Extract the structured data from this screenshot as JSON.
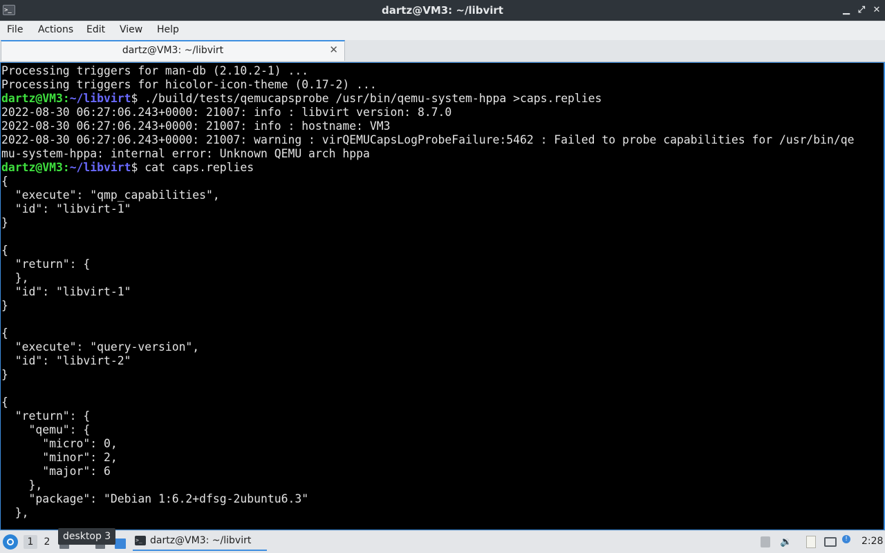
{
  "window": {
    "title": "dartz@VM3: ~/libvirt",
    "app_icon_glyph": ">_",
    "controls": {
      "minimize": "▁",
      "restore": "⤢",
      "close": "✕"
    }
  },
  "menu": {
    "items": [
      {
        "label": "File"
      },
      {
        "label": "Actions"
      },
      {
        "label": "Edit"
      },
      {
        "label": "View"
      },
      {
        "label": "Help"
      }
    ]
  },
  "tab": {
    "label": "dartz@VM3: ~/libvirt",
    "close_glyph": "✕"
  },
  "terminal": {
    "lines": [
      {
        "text": "Processing triggers for man-db (2.10.2-1) ..."
      },
      {
        "text": "Processing triggers for hicolor-icon-theme (0.17-2) ..."
      },
      {
        "prompt_user": "dartz@VM3",
        "prompt_sep": ":",
        "prompt_path": "~/libvirt",
        "prompt_sym": "$",
        "text": " ./build/tests/qemucapsprobe /usr/bin/qemu-system-hppa >caps.replies"
      },
      {
        "text": "2022-08-30 06:27:06.243+0000: 21007: info : libvirt version: 8.7.0"
      },
      {
        "text": "2022-08-30 06:27:06.243+0000: 21007: info : hostname: VM3"
      },
      {
        "text": "2022-08-30 06:27:06.243+0000: 21007: warning : virQEMUCapsLogProbeFailure:5462 : Failed to probe capabilities for /usr/bin/qe"
      },
      {
        "text": "mu-system-hppa: internal error: Unknown QEMU arch hppa"
      },
      {
        "prompt_user": "dartz@VM3",
        "prompt_sep": ":",
        "prompt_path": "~/libvirt",
        "prompt_sym": "$",
        "text": " cat caps.replies"
      },
      {
        "text": "{"
      },
      {
        "text": "  \"execute\": \"qmp_capabilities\","
      },
      {
        "text": "  \"id\": \"libvirt-1\""
      },
      {
        "text": "}"
      },
      {
        "text": ""
      },
      {
        "text": "{"
      },
      {
        "text": "  \"return\": {"
      },
      {
        "text": "  },"
      },
      {
        "text": "  \"id\": \"libvirt-1\""
      },
      {
        "text": "}"
      },
      {
        "text": ""
      },
      {
        "text": "{"
      },
      {
        "text": "  \"execute\": \"query-version\","
      },
      {
        "text": "  \"id\": \"libvirt-2\""
      },
      {
        "text": "}"
      },
      {
        "text": ""
      },
      {
        "text": "{"
      },
      {
        "text": "  \"return\": {"
      },
      {
        "text": "    \"qemu\": {"
      },
      {
        "text": "      \"micro\": 0,"
      },
      {
        "text": "      \"minor\": 2,"
      },
      {
        "text": "      \"major\": 6"
      },
      {
        "text": "    },"
      },
      {
        "text": "    \"package\": \"Debian 1:6.2+dfsg-2ubuntu6.3\""
      },
      {
        "text": "  },"
      }
    ]
  },
  "taskbar": {
    "desktops": [
      {
        "label": "1"
      },
      {
        "label": "2"
      }
    ],
    "tooltip": "desktop 3",
    "task": {
      "label": "dartz@VM3: ~/libvirt",
      "icon_glyph": ">_"
    },
    "tray": {
      "volume_glyph": "🔉",
      "update_glyph": "!"
    },
    "clock": "2:28"
  }
}
